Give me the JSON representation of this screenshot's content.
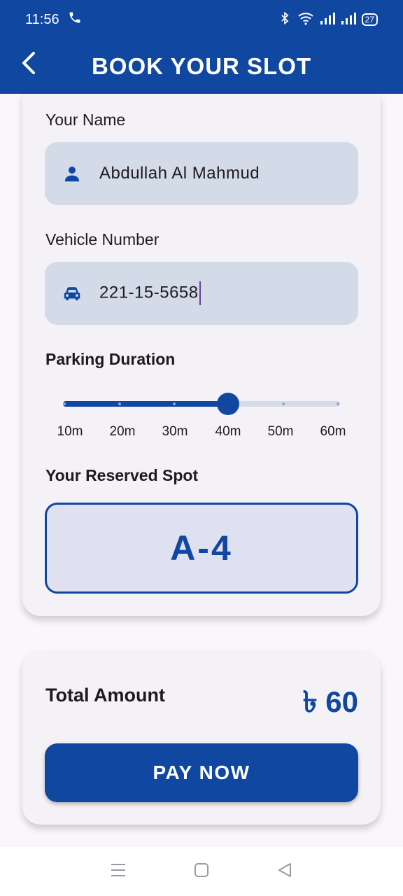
{
  "status_bar": {
    "time": "11:56",
    "battery": "27",
    "icons": [
      "phone-icon",
      "bluetooth-icon",
      "wifi-icon",
      "signal-icon",
      "signal-icon",
      "battery-icon"
    ]
  },
  "app_bar": {
    "title": "BOOK YOUR SLOT",
    "back_icon": "chevron-left-icon"
  },
  "form": {
    "name_label": "Your Name",
    "name_value": "Abdullah Al Mahmud",
    "name_icon": "person-icon",
    "vehicle_label": "Vehicle Number",
    "vehicle_value": "221-15-5658",
    "vehicle_icon": "car-icon",
    "duration_label": "Parking Duration",
    "duration_options": [
      "10m",
      "20m",
      "30m",
      "40m",
      "50m",
      "60m"
    ],
    "duration_selected": "40m",
    "spot_label": "Your Reserved Spot",
    "spot_value": "A-4"
  },
  "payment": {
    "total_label": "Total Amount",
    "total_value": "৳ 60",
    "pay_button": "PAY NOW"
  },
  "colors": {
    "primary": "#0f47a1",
    "field_bg": "#d3dbe8",
    "card_bg": "#f4f1f7"
  }
}
